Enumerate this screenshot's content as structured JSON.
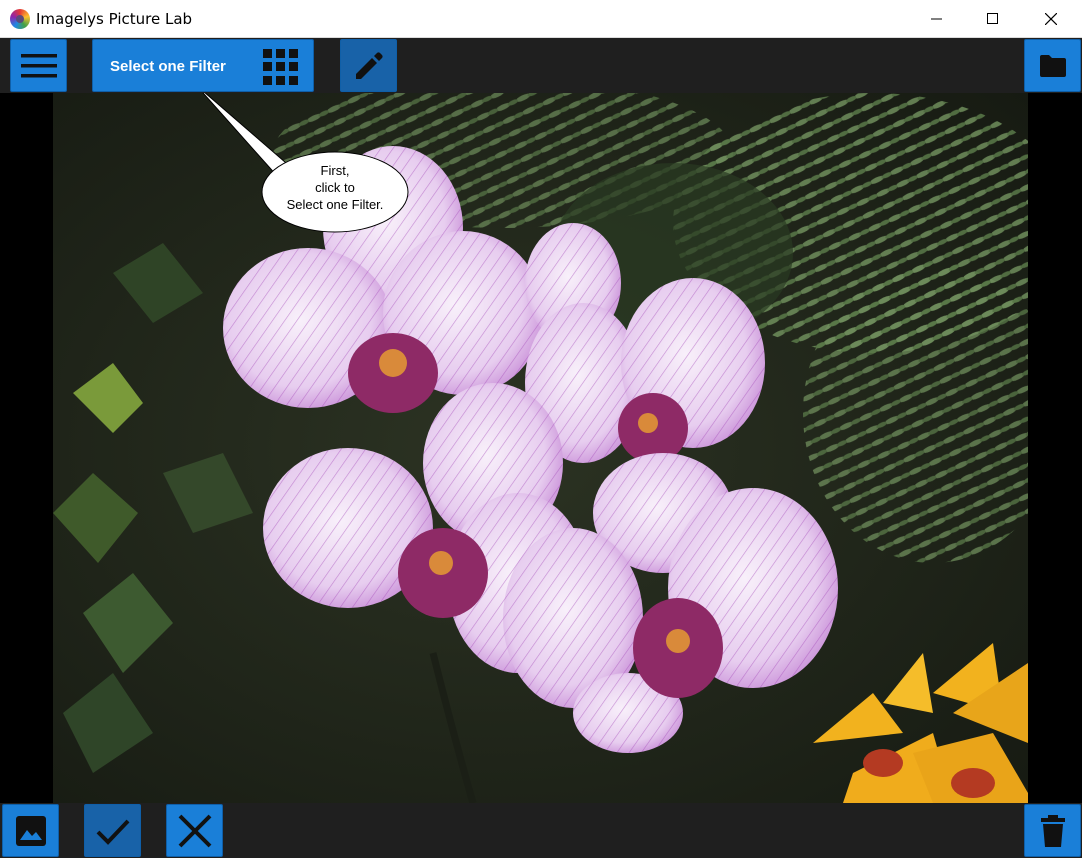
{
  "window": {
    "title": "Imagelys Picture Lab",
    "icon": "app-logo-icon"
  },
  "toolbar": {
    "menu_icon": "hamburger-menu-icon",
    "filter_button_label": "Select one Filter",
    "filter_icon": "grid-icon",
    "edit_icon": "pencil-icon",
    "open_icon": "folder-icon"
  },
  "callout": {
    "line1": "First,",
    "line2": "click to",
    "line3": "Select one Filter."
  },
  "bottombar": {
    "image_icon": "image-icon",
    "apply_icon": "checkmark-icon",
    "cancel_icon": "close-x-icon",
    "delete_icon": "trash-icon"
  },
  "colors": {
    "accent": "#1a7fd8",
    "toolbar_bg": "#1f1f1f"
  }
}
